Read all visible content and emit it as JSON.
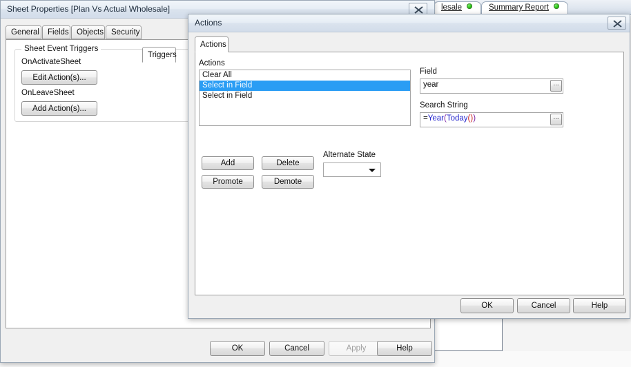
{
  "background": {
    "tabs": [
      {
        "label": "lesale",
        "status_color": "#23c310"
      },
      {
        "label": "Summary Report",
        "status_color": "#23c310"
      }
    ]
  },
  "sheet_properties": {
    "title": "Sheet Properties [Plan Vs Actual Wholesale]",
    "close_icon": "close-icon",
    "tabs": [
      {
        "label": "General",
        "active": false
      },
      {
        "label": "Fields",
        "active": false
      },
      {
        "label": "Objects",
        "active": false
      },
      {
        "label": "Security",
        "active": false
      },
      {
        "label": "Triggers",
        "active": true
      }
    ],
    "groupbox": {
      "title": "Sheet Event Triggers",
      "on_activate_label": "OnActivateSheet",
      "on_activate_button": "Edit Action(s)...",
      "on_leave_label": "OnLeaveSheet",
      "on_leave_button": "Add Action(s)..."
    },
    "footer": {
      "ok": "OK",
      "cancel": "Cancel",
      "apply": "Apply",
      "apply_disabled": true,
      "help": "Help"
    }
  },
  "actions_dialog": {
    "title": "Actions",
    "close_icon": "close-icon",
    "tabs": [
      {
        "label": "Actions",
        "active": true
      }
    ],
    "actions_list": {
      "label": "Actions",
      "items": [
        {
          "label": "Clear All",
          "selected": false
        },
        {
          "label": "Select in Field",
          "selected": true
        },
        {
          "label": "Select in Field",
          "selected": false
        }
      ]
    },
    "list_buttons": {
      "add": "Add",
      "delete": "Delete",
      "promote": "Promote",
      "demote": "Demote"
    },
    "alternate_state": {
      "label": "Alternate State",
      "value": "",
      "dropdown_icon": "chevron-down-icon"
    },
    "field": {
      "label": "Field",
      "value": "year",
      "browse_button": "...",
      "browse_icon": "ellipsis-icon"
    },
    "search_string": {
      "label": "Search String",
      "value": "=Year(Today())",
      "tokens": [
        {
          "text": "=",
          "color": "#000000"
        },
        {
          "text": "Year",
          "color": "#2222cc"
        },
        {
          "text": "(",
          "color": "#7a1fa2"
        },
        {
          "text": "Today",
          "color": "#2222cc"
        },
        {
          "text": "(",
          "color": "#cc2222"
        },
        {
          "text": ")",
          "color": "#cc2222"
        },
        {
          "text": ")",
          "color": "#7a1fa2"
        }
      ],
      "browse_button": "...",
      "browse_icon": "ellipsis-icon"
    },
    "footer": {
      "ok": "OK",
      "cancel": "Cancel",
      "help": "Help"
    }
  },
  "colors": {
    "selection_blue": "#2a9df4",
    "dialog_face": "#f0f0f0",
    "titlebar_top": "#f2f6fa",
    "titlebar_bottom": "#d2dcea"
  }
}
